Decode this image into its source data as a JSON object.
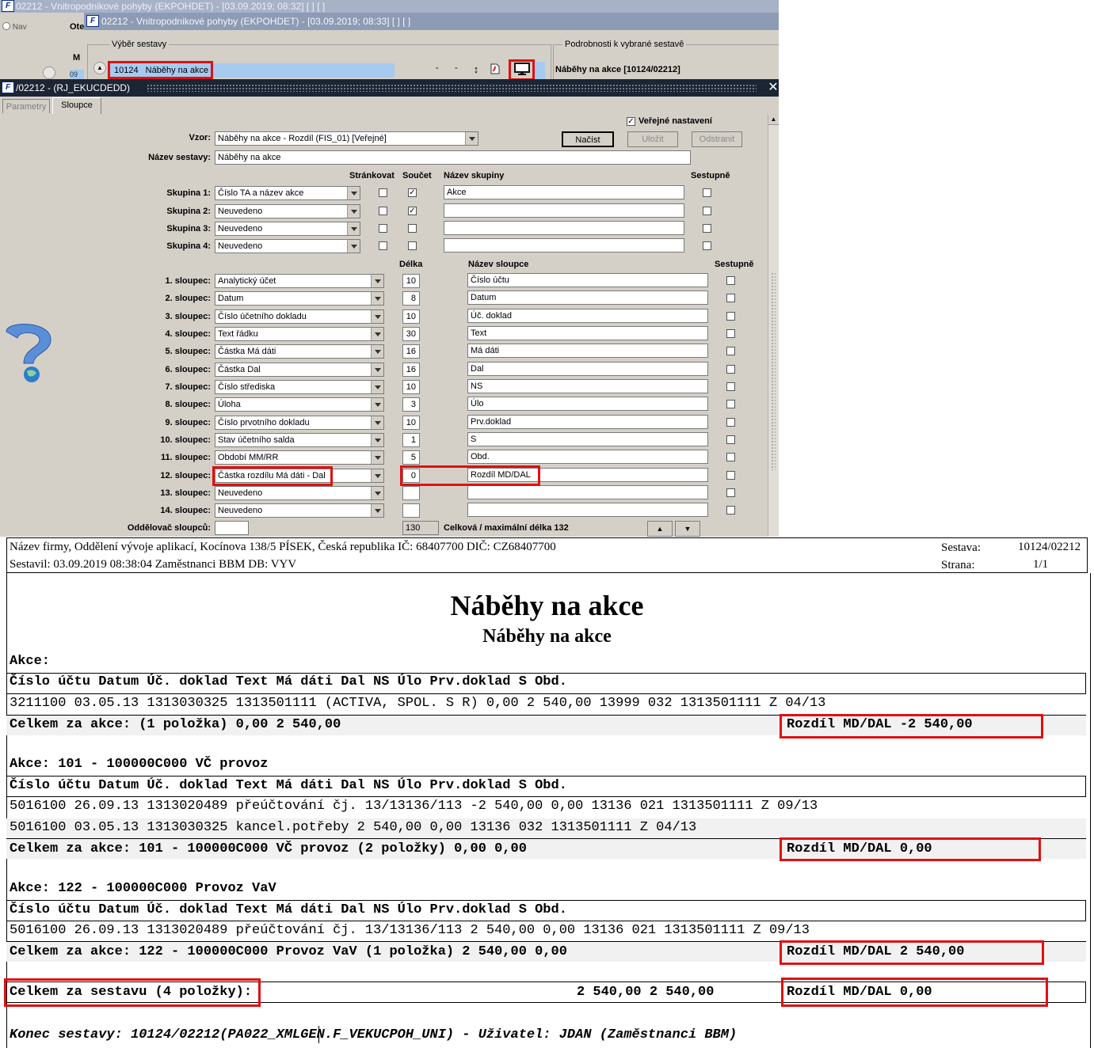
{
  "app": {
    "bg_title": "02212 - Vnitropodnikové pohyby (EKPOHDET) - [03.09.2019; 08:32]  [ ]  [ ]",
    "fg_title": "02212 - Vnitropodnikové pohyby (EKPOHDET) - [03.09.2019; 08:33]  [ ]  [ ]",
    "logo": "F",
    "left_nav": "Nav",
    "left_ote": "Ote",
    "left_m": "M",
    "left_09": "09",
    "vyber_legend": "Výběr sestavy",
    "sel_code": "10124",
    "sel_name": "Náběhy na akce",
    "dash1": "-",
    "dash2": "-",
    "podrobnosti_legend": "Podrobnosti k vybrané sestavě",
    "podrobnosti_value": "Náběhy na akce [10124/02212]",
    "dialog_title": "/02212 - (RJ_EKUCDEDD)",
    "close": "✕",
    "tabs": [
      "Parametry",
      "Sloupce"
    ]
  },
  "form": {
    "verejne_label": "Veřejné nastavení",
    "vzor_label": "Vzor:",
    "vzor_value": "Náběhy na akce - Rozdíl   (FIS_01)   [Veřejné]",
    "nazev_label": "Název sestavy:",
    "nazev_value": "Náběhy na akce",
    "btn_nacist": "Načíst",
    "btn_ulozit": "Uložit",
    "btn_odstranit": "Odstranit",
    "hdr_strankovat": "Stránkovat",
    "hdr_soucet": "Součet",
    "hdr_nazev_skupiny": "Název skupiny",
    "hdr_sestupne": "Sestupně",
    "groups": [
      {
        "label": "Skupina 1:",
        "value": "Číslo TA a název akce",
        "name": "Akce"
      },
      {
        "label": "Skupina 2:",
        "value": "Neuvedeno",
        "name": ""
      },
      {
        "label": "Skupina 3:",
        "value": "Neuvedeno",
        "name": ""
      },
      {
        "label": "Skupina 4:",
        "value": "Neuvedeno",
        "name": ""
      }
    ],
    "hdr_delka": "Délka",
    "hdr_nazev_sloupce": "Název sloupce",
    "hdr_sestupne2": "Sestupně",
    "columns": [
      {
        "label": "1. sloupec:",
        "value": "Analytický účet",
        "len": "10",
        "name": "Číslo účtu"
      },
      {
        "label": "2. sloupec:",
        "value": "Datum",
        "len": "8",
        "name": "Datum"
      },
      {
        "label": "3. sloupec:",
        "value": "Číslo účetního dokladu",
        "len": "10",
        "name": "Úč. doklad"
      },
      {
        "label": "4. sloupec:",
        "value": "Text řádku",
        "len": "30",
        "name": "Text"
      },
      {
        "label": "5. sloupec:",
        "value": "Částka Má dáti",
        "len": "16",
        "name": "Má dáti"
      },
      {
        "label": "6. sloupec:",
        "value": "Částka Dal",
        "len": "16",
        "name": "Dal"
      },
      {
        "label": "7. sloupec:",
        "value": "Číslo střediska",
        "len": "10",
        "name": "NS"
      },
      {
        "label": "8. sloupec:",
        "value": "Úloha",
        "len": "3",
        "name": "Úlo"
      },
      {
        "label": "9. sloupec:",
        "value": "Číslo prvotního dokladu",
        "len": "10",
        "name": "Prv.doklad"
      },
      {
        "label": "10. sloupec:",
        "value": "Stav účetního salda",
        "len": "1",
        "name": "S"
      },
      {
        "label": "11. sloupec:",
        "value": "Období MM/RR",
        "len": "5",
        "name": "Obd."
      },
      {
        "label": "12. sloupec:",
        "value": "Částka rozdílu Má dáti - Dal",
        "len": "0",
        "name": "Rozdíl MD/DAL"
      },
      {
        "label": "13. sloupec:",
        "value": "Neuvedeno",
        "len": "",
        "name": ""
      },
      {
        "label": "14. sloupec:",
        "value": "Neuvedeno",
        "len": "",
        "name": ""
      }
    ],
    "oddelovac_label": "Oddělovač sloupců:",
    "total_len": "130",
    "total_len_label": "Celková / maximální délka 132"
  },
  "report": {
    "firm": "Název firmy, Oddělení vývoje aplikací, Kocínova 138/5 PÍSEK, Česká republika  IČ: 68407700  DIČ: CZ68407700",
    "sestavil": "Sestavil: 03.09.2019 08:38:04 Zaměstnanci BBM  DB: VYV",
    "sestava_label": "Sestava:",
    "sestava_value": "10124/02212",
    "strana_label": "Strana:",
    "strana_value": "1/1",
    "title": "Náběhy na akce",
    "subtitle": "Náběhy na akce",
    "col_header": "Číslo účtu    Datum Úč. doklad Text                               Má dáti                 Dal NS          Úlo Prv.doklad S Obd.",
    "sections": [
      {
        "group": "Akce:",
        "rows": [
          "3211100     03.05.13 1313030325 1313501111 (ACTIVA, SPOL. S R)            0,00            2 540,00 13999        032 1313501111 Z 04/13"
        ],
        "total": "Celkem za akce:  (1 položka)                                          0,00            2 540,00",
        "diff": "Rozdíl MD/DAL          -2 540,00"
      },
      {
        "group": "Akce: 101 - 100000C000 VČ provoz",
        "rows": [
          "5016100     26.09.13 1313020489 přeúčtování čj. 13/13136/113          -2 540,00                0,00 13136        021 1313501111 Z 09/13",
          "5016100     03.05.13 1313030325 kancel.potřeby                         2 540,00                0,00 13136        032 1313501111 Z 04/13"
        ],
        "total": "Celkem za akce: 101 - 100000C000 VČ provoz (2 položky)                0,00                0,00",
        "diff": "Rozdíl MD/DAL               0,00"
      },
      {
        "group": "Akce: 122 - 100000C000 Provoz VaV",
        "rows": [
          "5016100     26.09.13 1313020489 přeúčtování čj. 13/13136/113           2 540,00                0,00 13136        021 1313501111 Z 09/13"
        ],
        "total": "Celkem za akce: 122 - 100000C000 Provoz VaV (1 položka)           2 540,00                0,00",
        "diff": "Rozdíl MD/DAL           2 540,00"
      }
    ],
    "grand_label": "Celkem za sestavu (4 položky):",
    "grand_values": "2 540,00            2 540,00",
    "grand_diff": "Rozdíl MD/DAL               0,00",
    "footer": "Konec sestavy: 10124/02212(PA022_XMLGEN.F_VEKUCPOH_UNI) - Uživatel: JDAN (Zaměstnanci BBM)"
  },
  "colors": {
    "highlight": "#e01010",
    "title_bar": "#1c2533",
    "selection": "#a6caf0"
  }
}
